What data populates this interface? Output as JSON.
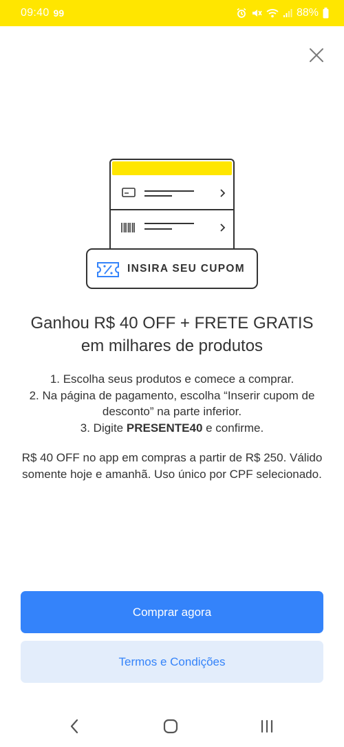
{
  "status_bar": {
    "time": "09:40",
    "notification": "99",
    "battery": "88%"
  },
  "illustration": {
    "coupon_label": "INSIRA SEU CUPOM"
  },
  "headline": "Ganhou R$ 40 OFF + FRETE GRATIS em milhares de produtos",
  "steps": {
    "step1": "1. Escolha seus produtos e comece a comprar.",
    "step2": "2. Na página de pagamento, escolha “Inserir cupom de desconto” na parte inferior.",
    "step3_prefix": "3. Digite ",
    "step3_code": "PRESENTE40",
    "step3_suffix": " e confirme."
  },
  "info": "R$ 40 OFF no app em compras a partir de R$ 250. Válido somente hoje e amanhã. Uso único por CPF selecionado.",
  "buttons": {
    "primary": "Comprar agora",
    "secondary": "Termos e Condições"
  },
  "colors": {
    "brand_yellow": "#ffe600",
    "primary_blue": "#3483fa",
    "secondary_bg": "#e3edfb"
  },
  "icons": {
    "close": "close-icon",
    "back": "back-icon",
    "home": "home-icon",
    "recents": "recents-icon"
  }
}
